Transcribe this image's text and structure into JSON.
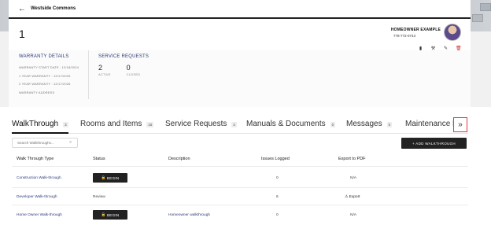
{
  "nav": {
    "back_icon": "←",
    "title": "Westside Commons"
  },
  "header": {
    "unit": "1",
    "owner_name": "HOMEOWNER EXAMPLE",
    "owner_phone": "778-772-0743",
    "actions": [
      {
        "name": "document-icon",
        "glyph": "▮"
      },
      {
        "name": "wrench-icon",
        "glyph": "⚒"
      },
      {
        "name": "pencil-icon",
        "glyph": "✎"
      },
      {
        "name": "trash-icon",
        "glyph": "🗑"
      }
    ]
  },
  "warranty": {
    "title": "WARRANTY DETAILS",
    "lines": [
      "WARRANTY START DATE : 12/18/2024",
      "1 YEAR WARRANTY : 12/17/2025",
      "2 YEAR WARRANTY : 12/17/2026",
      "WARRANTY ADDRESS"
    ]
  },
  "service": {
    "title": "SERVICE REQUESTS",
    "active_count": "2",
    "active_label": "ACTIVE",
    "closed_count": "0",
    "closed_label": "CLOSED"
  },
  "tabs": [
    {
      "label": "WalkThrough",
      "badge": "3",
      "active": true
    },
    {
      "label": "Rooms and Items",
      "badge": "16"
    },
    {
      "label": "Service Requests",
      "badge": "2"
    },
    {
      "label": "Manuals & Documents",
      "badge": "0"
    },
    {
      "label": "Messages",
      "badge": "0"
    },
    {
      "label": "Maintenance Re"
    }
  ],
  "more_tabs_icon": "»",
  "search": {
    "placeholder": "Search Walkthroughs...",
    "icon": "⌕"
  },
  "add_button": "+ ADD WALKTHROUGH",
  "table": {
    "headers": [
      "Walk Through Type",
      "Status",
      "Description",
      "Issues Logged",
      "Export to PDF"
    ],
    "rows": [
      {
        "type": "Construction Walk-through",
        "status": "BEGIN",
        "description": "",
        "issues": "0",
        "export": "N/A"
      },
      {
        "type": "Developer Walk-through",
        "status": "Review",
        "description": "",
        "issues": "6",
        "export": "Export"
      },
      {
        "type": "Home Owner Walk-through",
        "status": "BEGIN",
        "description": "Homeowner walkthrough",
        "issues": "0",
        "export": "N/A"
      }
    ]
  },
  "colors": {
    "accent_navy": "#2c3b7a",
    "danger": "#d32f2f",
    "dark_button": "#222222"
  }
}
